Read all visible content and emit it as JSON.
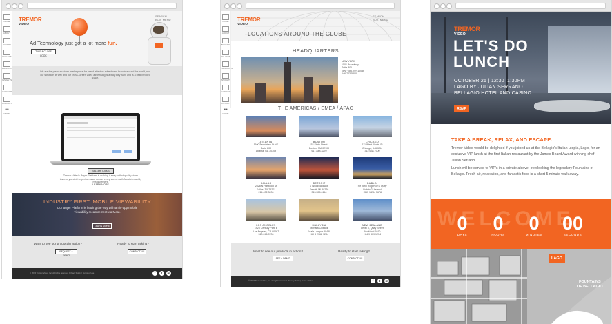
{
  "page1": {
    "logo": "TREMOR",
    "logo_sub": "VIDEO",
    "nav": [
      "SEARCH BOX",
      "MENU"
    ],
    "sidebar": [
      "HOME",
      "ABOUT",
      "BUYERS",
      "SELLERS",
      "PRODUCTS",
      "INSIGHTS",
      "CAREERS",
      "CONTACT",
      "MORE"
    ],
    "hero_headline": "Ad Technology just got a lot more",
    "hero_headline_accent": "fun.",
    "hero_button": "TAKE A CLOSE LOOK",
    "intro_text": "We are the premium video marketplace for brand-effective advertisers, brands around the world, and our software as well and our cross-screen video advertising is a way they want and is a best in video space.",
    "product_button": "SELLER TOOLS",
    "product_caption": "Tremor Video's Buyer Platform is making it easy to find quality video inventory and drive performance across every screen with Moat viewability measurement.",
    "product_link": "LEARN MORE",
    "banner_title": "INDUSTRY FIRST: MOBILE VIEWABILITY",
    "banner_text": "Our Buyer Platform is leading the way with an in-app mobile viewability measurement via Moat.",
    "banner_button": "LEARN MORE",
    "cta_left_q": "Want to see our product in action?",
    "cta_left_btn": "REQUEST A DEMO",
    "cta_right_q": "Ready to start talking?",
    "cta_right_btn": "CONTACT US",
    "footer_text": "© 2015 Tremor Video, Inc. All rights reserved. Privacy Policy | Terms of Use"
  },
  "page2": {
    "logo": "TREMOR",
    "logo_sub": "VIDEO",
    "nav": [
      "SEARCH BOX",
      "MENU"
    ],
    "sidebar": [
      "HOME",
      "ABOUT",
      "BUYERS",
      "SELLERS",
      "PRODUCTS",
      "INSIGHTS",
      "CAREERS",
      "CONTACT",
      "MORE"
    ],
    "title": "LOCATIONS AROUND THE GLOBE",
    "hq_heading": "HEADQUARTERS",
    "hq_city": "NEW YORK",
    "hq_address": [
      "1501 Broadway",
      "Suite 801",
      "New York, NY 10036",
      "646.723.5300"
    ],
    "regions_heading": "THE AMERICAS / EMEA / APAC",
    "offices": [
      {
        "city": "ATLANTA",
        "addr": [
          "1100 Peachtree St NE",
          "Suite 200",
          "Atlanta, GA 30309"
        ]
      },
      {
        "city": "BOSTON",
        "addr": [
          "53 State Street",
          "Boston, MA 02109",
          "617.848.3270"
        ]
      },
      {
        "city": "CHICAGO",
        "addr": [
          "111 West Illinois St",
          "Chicago, IL 60654",
          "312.638.7900"
        ]
      },
      {
        "city": "DALLAS",
        "addr": [
          "2828 N Harwood St",
          "Dallas, TX 75201",
          "214.432.3200"
        ]
      },
      {
        "city": "DETROIT",
        "addr": [
          "1 Woodward Ave",
          "Detroit, MI 48226",
          "313.555.0144"
        ]
      },
      {
        "city": "DUBLIN",
        "addr": [
          "Sir John Rogerson's Quay",
          "Dublin 2, Ireland",
          "+353 1 234 5678"
        ]
      },
      {
        "city": "LOS ANGELES",
        "addr": [
          "1925 Century Park E",
          "Los Angeles, CA 90067",
          "310.246.8700"
        ]
      },
      {
        "city": "MALAYSIA",
        "addr": [
          "Menara Citibank",
          "Kuala Lumpur 50450",
          "+60 3 2162 1234"
        ]
      },
      {
        "city": "NEW ZEALAND",
        "addr": [
          "Level 5, Quay Street",
          "Auckland 1010",
          "+64 9 309 1234"
        ]
      }
    ],
    "cta_left_q": "Want to see our products in action?",
    "cta_left_btn": "SEE A DEMO",
    "cta_right_q": "Ready to start talking?",
    "cta_right_btn": "CONTACT US",
    "footer_text": "© 2015 Tremor Video, Inc. All rights reserved. Privacy Policy | Terms of Use"
  },
  "email": {
    "logo": "TREMOR",
    "logo_sub": "VIDEO",
    "headline_1": "LET'S DO",
    "headline_2": "LUNCH",
    "details": [
      "OCTOBER 26 | 12:30–1:30PM",
      "LAGO BY JULIAN SERRANO",
      "BELLAGIO HOTEL AND CASINO"
    ],
    "rsvp": "RSVP",
    "section_title": "TAKE A BREAK, RELAX, AND ESCAPE.",
    "para_1": "Tremor Video would be delighted if you joined us at the Bellagio's Italian utopia, Lago, for an exclusive VIP lunch at the first Italian restaurant by the James Beard Award-winning chef Julian Serrano.",
    "para_2": "Lunch will be served to VIP's in a private alcove, overlooking the legendary Fountains of Bellagio. Fresh air, relaxation, and fantastic food is a short 5 minute walk away.",
    "sign_word": "WELCOME",
    "countdown": [
      {
        "value": "0",
        "label": "DAYS"
      },
      {
        "value": "0",
        "label": "HOURS"
      },
      {
        "value": "0",
        "label": "MINUTES"
      },
      {
        "value": "00",
        "label": "SECONDS"
      }
    ],
    "map_pin": "LAGO",
    "map_label_1": "FOUNTAINS",
    "map_label_2": "OF BELLAGIO"
  },
  "colors": {
    "brand_orange": "#f26522",
    "dark": "#2b2b2b",
    "grey_band": "#e5e5e5"
  }
}
